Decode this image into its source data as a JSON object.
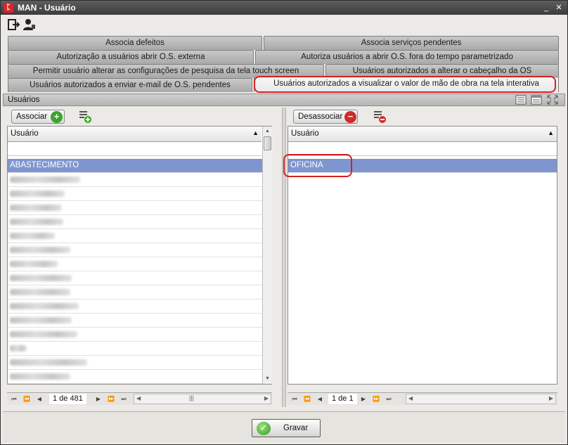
{
  "window": {
    "title": "MAN - Usuário",
    "minimize": "_",
    "close": "✕"
  },
  "toolbar": {
    "icons": [
      "exit-icon",
      "user-icon"
    ]
  },
  "tabs": {
    "row1": [
      "Associa defeitos",
      "Associa serviços pendentes"
    ],
    "row2": [
      "Autorização a usuários abrir O.S. externa",
      "Autoriza usuários a abrir O.S. fora do tempo parametrizado"
    ],
    "row3": [
      "Permitir usuário alterar as configurações de pesquisa da tela touch screen",
      "Usuários autorizados a alterar o cabeçalho da OS"
    ],
    "row4": [
      "Usuários autorizados a enviar e-mail de O.S. pendentes",
      "Usuários autorizados a visualizar o valor de mão de obra na tela interativa"
    ],
    "active": "Usuários autorizados a visualizar o valor de mão de obra na tela interativa"
  },
  "section": {
    "title": "Usuários"
  },
  "left": {
    "button_label": "Associar",
    "column_header": "Usuário",
    "selected_row": "ABASTECIMENTO",
    "pager_text": "1 de 481"
  },
  "right": {
    "button_label": "Desassociar",
    "column_header": "Usuário",
    "selected_row": "OFICINA",
    "pager_text": "1 de 1"
  },
  "footer": {
    "save_label": "Gravar"
  },
  "colors": {
    "selection": "#7e95cf",
    "highlight_ring": "#d62020",
    "add_icon": "#3aa52b",
    "remove_icon": "#d12b2b"
  }
}
